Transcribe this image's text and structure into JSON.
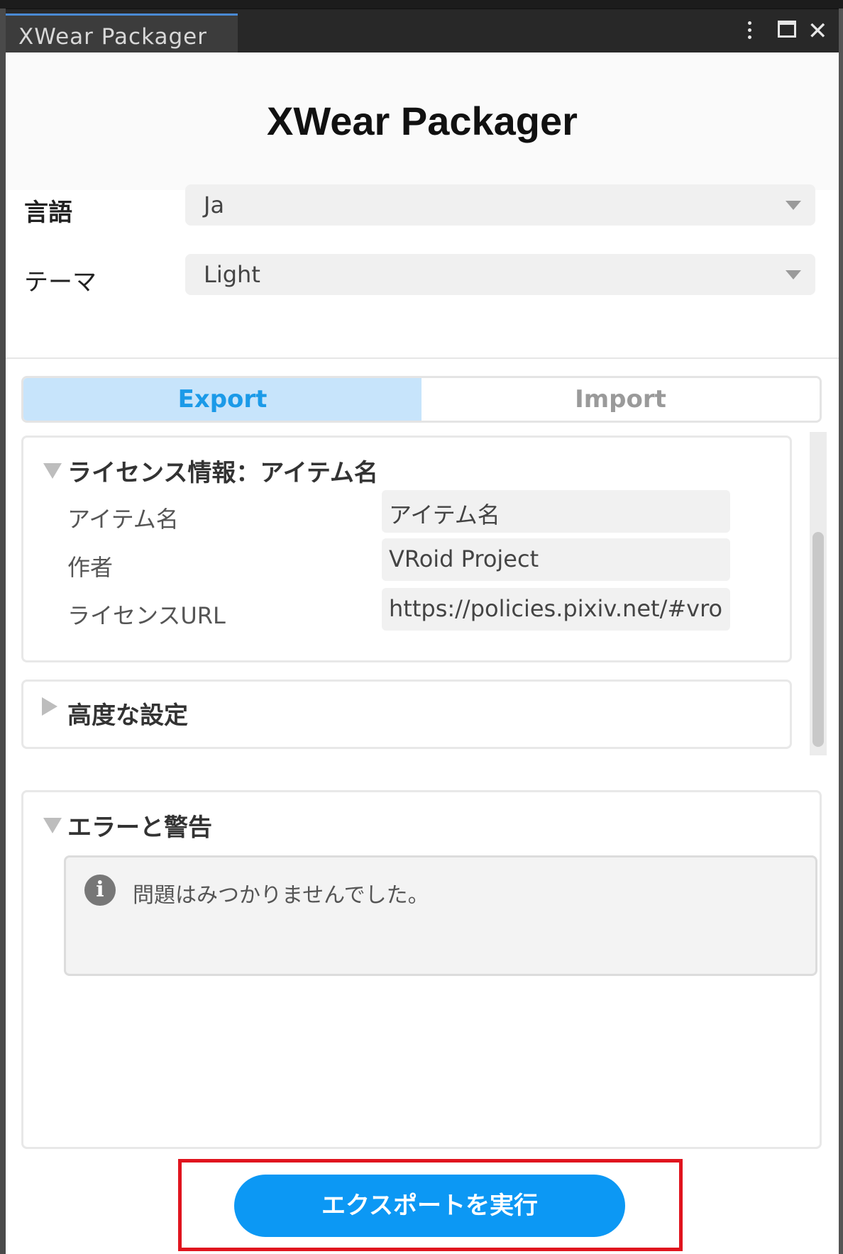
{
  "window": {
    "tab_title": "XWear Packager"
  },
  "header": {
    "title": "XWear Packager"
  },
  "settings": {
    "language_label": "言語",
    "language_value": "Ja",
    "theme_label": "テーマ",
    "theme_value": "Light"
  },
  "mode_tabs": {
    "export_label": "Export",
    "import_label": "Import",
    "selected": "Export"
  },
  "license_section": {
    "title": "ライセンス情報：アイテム名",
    "rows": [
      {
        "label": "アイテム名",
        "value": "アイテム名"
      },
      {
        "label": "作者",
        "value": "VRoid Project"
      },
      {
        "label": "ライセンスURL",
        "value": "https://policies.pixiv.net/#vro"
      }
    ]
  },
  "advanced_section": {
    "title": "高度な設定"
  },
  "errors_section": {
    "title": "エラーと警告",
    "message": "問題はみつかりませんでした。"
  },
  "actions": {
    "export_button_label": "エクスポートを実行"
  },
  "colors": {
    "accent": "#0c98f4",
    "selected_tab_bg": "#c7e4fb",
    "highlight_frame": "#e0141e"
  },
  "icons": [
    "kebab-menu-icon",
    "maximize-icon",
    "close-icon",
    "chevron-down-icon",
    "info-icon"
  ]
}
